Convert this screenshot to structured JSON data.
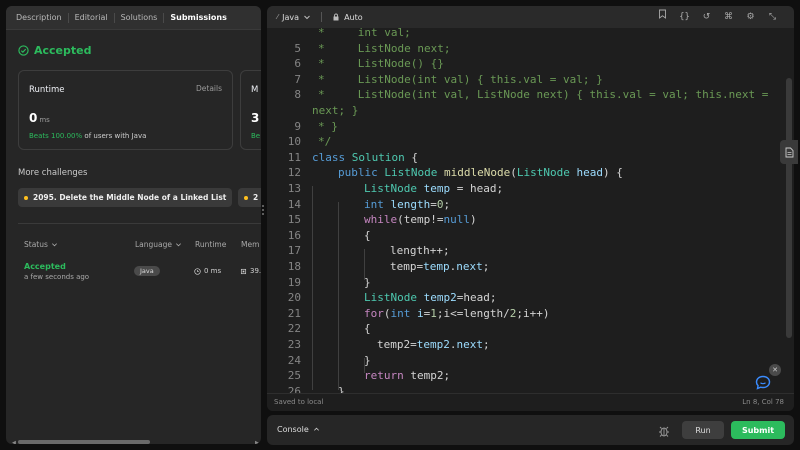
{
  "left_panel": {
    "tabs": [
      {
        "label": "Description"
      },
      {
        "label": "Editorial"
      },
      {
        "label": "Solutions"
      },
      {
        "label": "Submissions"
      }
    ],
    "result": {
      "status": "Accepted"
    },
    "runtime_card": {
      "label": "Runtime",
      "details": "Details",
      "value": "0",
      "unit": "ms",
      "beats_pct": "Beats 100.00%",
      "beats_rest": "of users with Java"
    },
    "memory_card": {
      "label": "M",
      "value": "3",
      "beats": "Be"
    },
    "more_challenges": {
      "title": "More challenges",
      "items": [
        {
          "label": "2095. Delete the Middle Node of a Linked List"
        },
        {
          "label": "2"
        }
      ]
    },
    "submissions_table": {
      "headers": {
        "status": "Status",
        "language": "Language",
        "runtime": "Runtime",
        "memory": "Mem"
      },
      "row": {
        "status": "Accepted",
        "time": "a few seconds ago",
        "language": "Java",
        "runtime": "0 ms",
        "memory": "39."
      }
    }
  },
  "editor": {
    "language": "Java",
    "mode": "Auto",
    "toolbar_icons": [
      "bookmark-icon",
      "braces-icon",
      "reset-icon",
      "command-icon",
      "settings-icon",
      "collapse-icon"
    ],
    "lines": [
      {
        "n": "",
        "text": "*     int val;"
      },
      {
        "n": "5",
        "text": "*     ListNode next;"
      },
      {
        "n": "6",
        "text": "*     ListNode() {}"
      },
      {
        "n": "7",
        "text": "*     ListNode(int val) { this.val = val; }"
      },
      {
        "n": "8",
        "text": "*     ListNode(int val, ListNode next) { this.val = val; this.next ="
      },
      {
        "n": "",
        "text": "next; }"
      },
      {
        "n": "9",
        "text": "* }"
      },
      {
        "n": "10",
        "text": "*/"
      },
      {
        "n": "11",
        "text": "class Solution {"
      },
      {
        "n": "12",
        "text": "public ListNode middleNode(ListNode head) {"
      },
      {
        "n": "13",
        "text": "ListNode temp = head;"
      },
      {
        "n": "14",
        "text": "int length=0;"
      },
      {
        "n": "15",
        "text": "while(temp!=null)"
      },
      {
        "n": "16",
        "text": "{"
      },
      {
        "n": "17",
        "text": "length++;"
      },
      {
        "n": "18",
        "text": "temp=temp.next;"
      },
      {
        "n": "19",
        "text": "}"
      },
      {
        "n": "20",
        "text": "ListNode temp2=head;"
      },
      {
        "n": "21",
        "text": "for(int i=1;i<=length/2;i++)"
      },
      {
        "n": "22",
        "text": "{"
      },
      {
        "n": "23",
        "text": "temp2=temp2.next;"
      },
      {
        "n": "24",
        "text": "}"
      },
      {
        "n": "25",
        "text": "return temp2;"
      },
      {
        "n": "26",
        "text": "}"
      }
    ],
    "footer": {
      "saved": "Saved to local",
      "cursor": "Ln 8, Col 78"
    }
  },
  "bottom_bar": {
    "console": "Console",
    "run": "Run",
    "submit": "Submit"
  },
  "colors": {
    "accent_green": "#2cbb5d",
    "comment": "#6a9955",
    "keyword": "#569cd6",
    "type": "#4ec9b0",
    "function": "#dcdcaa",
    "variable": "#9cdcfe",
    "number": "#b5cea8"
  }
}
